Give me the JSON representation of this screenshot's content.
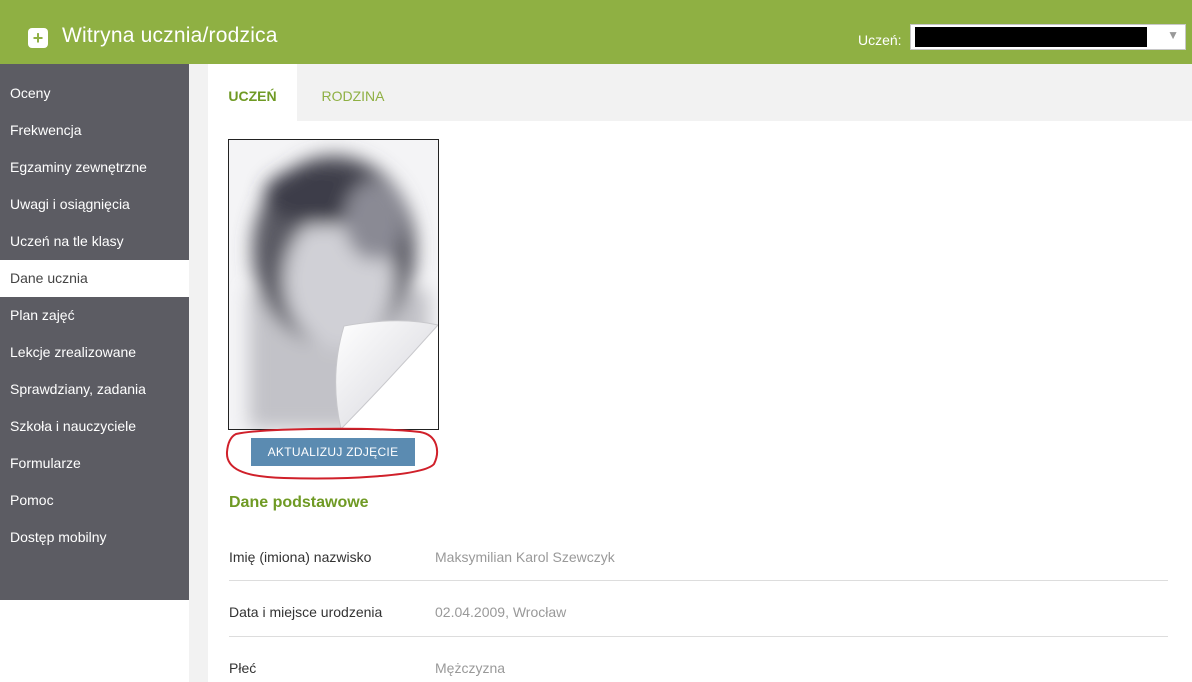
{
  "app": {
    "title": "Witryna ucznia/rodzica",
    "icon": "plus-speech-bubble-icon"
  },
  "header": {
    "student_label": "Uczeń:",
    "student_value": ""
  },
  "sidebar": {
    "items": [
      {
        "label": "Oceny"
      },
      {
        "label": "Frekwencja"
      },
      {
        "label": "Egzaminy zewnętrzne"
      },
      {
        "label": "Uwagi i osiągnięcia"
      },
      {
        "label": "Uczeń na tle klasy"
      },
      {
        "label": "Dane ucznia",
        "active": true
      },
      {
        "label": "Plan zajęć"
      },
      {
        "label": "Lekcje zrealizowane"
      },
      {
        "label": "Sprawdziany, zadania"
      },
      {
        "label": "Szkoła i nauczyciele"
      },
      {
        "label": "Formularze"
      },
      {
        "label": "Pomoc"
      },
      {
        "label": "Dostęp mobilny"
      }
    ]
  },
  "tabs": [
    {
      "label": "UCZEŃ",
      "active": true
    },
    {
      "label": "RODZINA",
      "active": false
    }
  ],
  "photo": {
    "update_button": "AKTUALIZUJ ZDJĘCIE"
  },
  "basic_data": {
    "title": "Dane podstawowe",
    "rows": [
      {
        "label": "Imię (imiona) nazwisko",
        "value": "Maksymilian Karol Szewczyk"
      },
      {
        "label": "Data i miejsce urodzenia",
        "value": "02.04.2009, Wrocław"
      },
      {
        "label": "Płeć",
        "value": "Mężczyzna"
      }
    ]
  },
  "colors": {
    "brand_green": "#8fb043",
    "sidebar_bg": "#5c5c63",
    "button_blue": "#5b8bb1",
    "annotation_red": "#d0202a"
  }
}
